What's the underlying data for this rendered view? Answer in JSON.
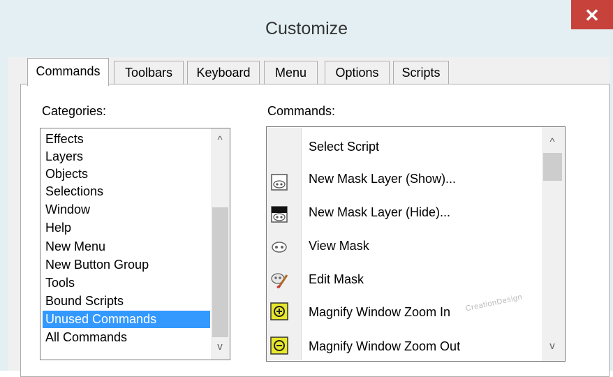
{
  "window": {
    "title": "Customize",
    "close_label": "✕"
  },
  "tabs": [
    {
      "label": "Commands",
      "active": true
    },
    {
      "label": "Toolbars",
      "active": false
    },
    {
      "label": "Keyboard",
      "active": false
    },
    {
      "label": "Menu",
      "active": false
    },
    {
      "label": "Options",
      "active": false
    },
    {
      "label": "Scripts",
      "active": false
    }
  ],
  "categories": {
    "label": "Categories:",
    "items": [
      "Effects",
      "Layers",
      "Objects",
      "Selections",
      "Window",
      "Help",
      "New Menu",
      "New Button Group",
      "Tools",
      "Bound Scripts",
      "Unused Commands",
      "All Commands"
    ],
    "selected": "Unused Commands"
  },
  "commands": {
    "label": "Commands:",
    "items": [
      {
        "label": "Select Script",
        "icon": "none"
      },
      {
        "label": "New Mask Layer (Show)...",
        "icon": "mask-show-icon"
      },
      {
        "label": "New Mask Layer (Hide)...",
        "icon": "mask-hide-icon"
      },
      {
        "label": "View Mask",
        "icon": "view-mask-icon"
      },
      {
        "label": "Edit Mask",
        "icon": "edit-mask-icon"
      },
      {
        "label": "Magnify Window Zoom In",
        "icon": "zoom-in-icon"
      },
      {
        "label": "Magnify Window Zoom Out",
        "icon": "zoom-out-icon"
      }
    ]
  },
  "scroll_arrows": {
    "up": "^",
    "down": "v"
  },
  "watermark": "CreationDesign",
  "colors": {
    "titlebar": "#e4eff3",
    "close": "#c8423c",
    "selection": "#3399ff",
    "zoom_icon": "#e7e72b"
  }
}
